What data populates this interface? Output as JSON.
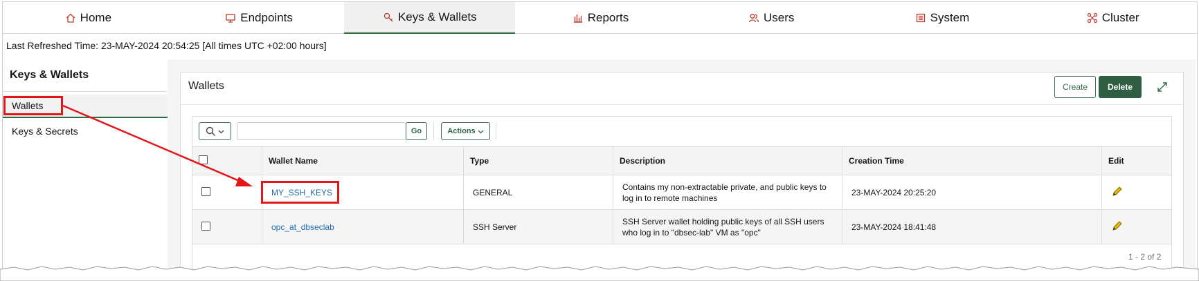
{
  "nav": {
    "tabs": [
      {
        "label": "Home",
        "icon": "home-icon"
      },
      {
        "label": "Endpoints",
        "icon": "monitor-icon"
      },
      {
        "label": "Keys & Wallets",
        "icon": "key-icon",
        "active": true
      },
      {
        "label": "Reports",
        "icon": "bar-chart-icon"
      },
      {
        "label": "Users",
        "icon": "users-icon"
      },
      {
        "label": "System",
        "icon": "system-icon"
      },
      {
        "label": "Cluster",
        "icon": "cluster-icon"
      }
    ]
  },
  "refresh_text": "Last Refreshed Time: 23-MAY-2024 20:54:25 [All times UTC +02:00 hours]",
  "sidebar": {
    "title": "Keys & Wallets",
    "items": [
      {
        "label": "Wallets",
        "active": true
      },
      {
        "label": "Keys & Secrets",
        "active": false
      }
    ]
  },
  "panel": {
    "title": "Wallets",
    "create_label": "Create",
    "delete_label": "Delete"
  },
  "toolbar": {
    "search_value": "",
    "go_label": "Go",
    "actions_label": "Actions"
  },
  "table": {
    "columns": [
      "Wallet Name",
      "Type",
      "Description",
      "Creation Time",
      "Edit"
    ],
    "rows": [
      {
        "name": "MY_SSH_KEYS",
        "type": "GENERAL",
        "desc1": "Contains my non-extractable private, and public keys to",
        "desc2": "log in to remote machines",
        "created": "23-MAY-2024 20:25:20"
      },
      {
        "name": "opc_at_dbseclab",
        "type": "SSH Server",
        "desc1": "SSH Server wallet holding public keys of all SSH users",
        "desc2": "who log in to \"dbsec-lab\" VM as \"opc\"",
        "created": "23-MAY-2024 18:41:48"
      }
    ],
    "pagination": "1 - 2 of 2"
  },
  "colors": {
    "accent_green": "#2f6a45",
    "link_blue": "#1d6bb5",
    "annotation_red": "#e4161a",
    "nav_icon_red": "#c0392b"
  }
}
